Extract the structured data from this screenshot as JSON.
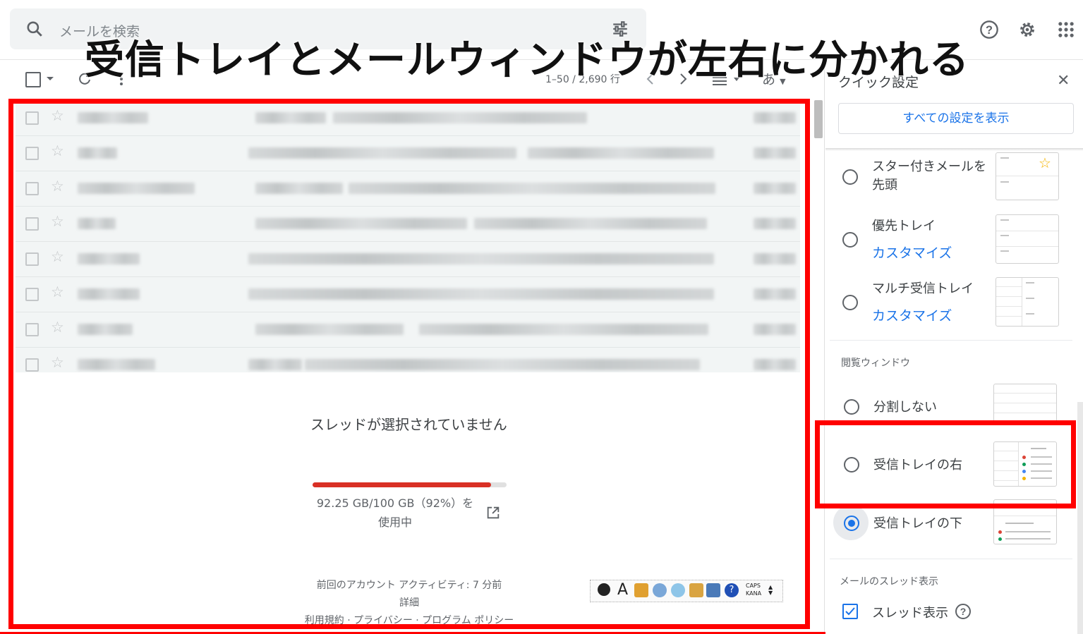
{
  "search": {
    "placeholder": "メールを検索"
  },
  "headline": "受信トレイとメールウィンドウが左右に分かれる",
  "toolbar": {
    "page_range": "1–50 / 2,690 行",
    "lang_button": "あ"
  },
  "mail_rows_count_visible": 8,
  "reading_pane": {
    "no_thread": "スレッドが選択されていません",
    "storage_used_fraction": 0.92,
    "storage_line1": "92.25 GB/100 GB（92%）を",
    "storage_line2": "使用中",
    "activity_line1": "前回のアカウント アクティビティ: 7 分前",
    "activity_line2": "詳細",
    "activity_line3": "利用規約 · プライバシー · プログラム ポリシー"
  },
  "quick_settings": {
    "title": "クイック設定",
    "all_settings_button": "すべての設定を表示",
    "inbox_types": [
      {
        "label_line1": "スター付きメールを",
        "label_line2": "先頭",
        "link": ""
      },
      {
        "label_line1": "優先トレイ",
        "label_line2": "",
        "link": "カスタマイズ"
      },
      {
        "label_line1": "マルチ受信トレイ",
        "label_line2": "",
        "link": "カスタマイズ"
      }
    ],
    "reading_pane_section": "閲覧ウィンドウ",
    "reading_pane_options": [
      {
        "label": "分割しない",
        "selected": false
      },
      {
        "label": "受信トレイの右",
        "selected": false
      },
      {
        "label": "受信トレイの下",
        "selected": true
      }
    ],
    "thread_section": "メールのスレッド表示",
    "thread_option": "スレッド表示",
    "thread_checked": true
  },
  "ime_toolbar": {
    "caps_label": "CAPS",
    "kana_label": "KANA"
  },
  "colors": {
    "highlight_red": "#ff0000",
    "accent_blue": "#1a73e8",
    "storage_red": "#d93025"
  }
}
